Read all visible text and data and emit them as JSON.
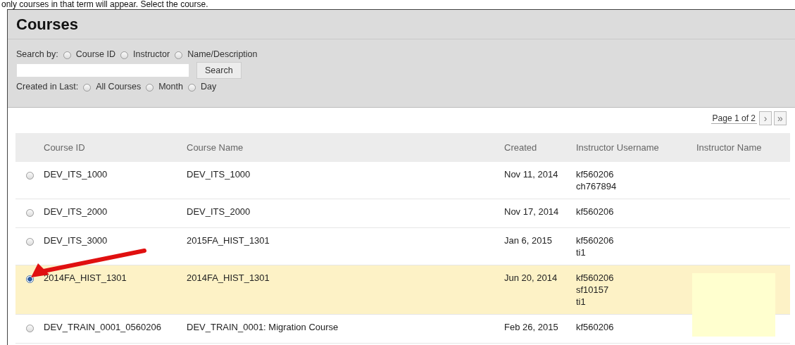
{
  "intro_text": "only courses in that term will appear. Select the course.",
  "panel": {
    "title": "Courses",
    "search_by": {
      "label": "Search by:",
      "options": [
        {
          "label": "Course ID",
          "selected": false
        },
        {
          "label": "Instructor",
          "selected": false
        },
        {
          "label": "Name/Description",
          "selected": false
        }
      ]
    },
    "search_button": "Search",
    "created_in_last": {
      "label": "Created in Last:",
      "options": [
        {
          "label": "All Courses",
          "selected": false
        },
        {
          "label": "Month",
          "selected": false
        },
        {
          "label": "Day",
          "selected": false
        }
      ]
    }
  },
  "pagination": {
    "label": "Page 1 of 2",
    "next": "›",
    "last": "»"
  },
  "table": {
    "columns": [
      "Course ID",
      "Course Name",
      "Created",
      "Instructor Username",
      "Instructor Name"
    ],
    "rows": [
      {
        "selected": false,
        "course_id": "DEV_ITS_1000",
        "course_name": "DEV_ITS_1000",
        "created": "Nov 11, 2014",
        "usernames": [
          "kf560206",
          "ch767894"
        ]
      },
      {
        "selected": false,
        "course_id": "DEV_ITS_2000",
        "course_name": "DEV_ITS_2000",
        "created": "Nov 17, 2014",
        "usernames": [
          "kf560206"
        ]
      },
      {
        "selected": false,
        "course_id": "DEV_ITS_3000",
        "course_name": "2015FA_HIST_1301",
        "created": "Jan 6, 2015",
        "usernames": [
          "kf560206",
          "ti1"
        ]
      },
      {
        "selected": true,
        "course_id": "2014FA_HIST_1301",
        "course_name": "2014FA_HIST_1301",
        "created": "Jun 20, 2014",
        "usernames": [
          "kf560206",
          "sf10157",
          "ti1"
        ]
      },
      {
        "selected": false,
        "course_id": "DEV_TRAIN_0001_0560206",
        "course_name": "DEV_TRAIN_0001: Migration Course",
        "created": "Feb 26, 2015",
        "usernames": [
          "kf560206"
        ]
      }
    ]
  }
}
